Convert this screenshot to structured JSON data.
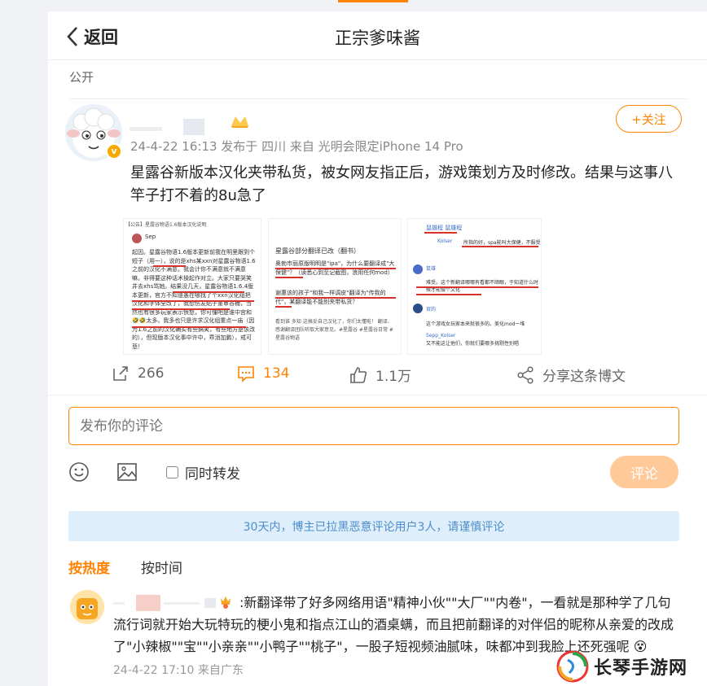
{
  "header": {
    "back_label": "返回",
    "title": "正宗爹味酱"
  },
  "visibility": "公开",
  "post": {
    "meta": "24-4-22 16:13  发布于 四川  来自 光明会限定iPhone 14 Pro",
    "follow_label": "+关注",
    "text": "星露谷新版本汉化夹带私货，被女网友指正后，游戏策划方及时修改。结果与这事八竿子打不着的8u急了",
    "images": [
      {
        "title": "【公告】星露谷物语1.6版本汉化说明",
        "author": "Sep",
        "paragraph": "起因。星露谷物语1.6版本更新前我在明里跟到个短子（用一），说的是xhs某xxn对星露谷物语1.6之前的汉化不满意。我会计你不满意就不满意嘛。非得要这种话术操起作对立。大家只要哭笑井去xhs骂她。结果没几天，星露谷物语1.6.4版本更新，官方不知道愚在哪找了个xxn汉化组把汉化和字体全改了，我想伤友贴子重审谷桶，当然也有很多玩家表示愤怒，你可懂吧是谁中宫和🤣🤣太多。我多也只是许求汉化组重点一庙（因为1.6之前的汉化确实有些搞笑，有些地方是该改的），但现版本汉化事中许中，乖消加鹏），戒可悲！"
      },
      {
        "heading": "星露谷部分翻译已改（翻书）",
        "body1": "奥勃市丽原版明明是\"ipa\"，为什么要翻译成\"大保健\"？（读悉心到至记截图，浪用任何mod）",
        "body2": "谢惠该的孩子\"和我一样调皮\"翻译为\"传我的代\"，某翻译能不能别夹带私货？",
        "footer": "看到谁 多知 这搞妥自己汉化了，你们太懂啦！   翻译、感谢翻译团队听取大家意见。#星露谷 #星露谷日常 #星露谷物语"
      },
      {
        "top": "鼠雄程 鼠雄程",
        "c1_name": "Kolser",
        "c1_text": "所指的好，spa能叫大保健，不服受着",
        "c2_name": "鼠雄",
        "c2_text": "难受。这个新翻译哪哪有看都不顺眼，于知道什么时候才能做个文化",
        "c3_name": "官的",
        "c3_text": "这个游戏女玩家本来就很多的。美化mod一堆",
        "c4_name": "Sepp_Kolser",
        "c4_text": "又不能这让他们，你就们要哪多挑剔性别唱"
      }
    ]
  },
  "actions": {
    "repost_count": "266",
    "comment_count": "134",
    "like_count": "1.1万",
    "share_label": "分享这条博文"
  },
  "composer": {
    "placeholder": "发布你的评论",
    "repost_label": "同时转发",
    "submit_label": "评论"
  },
  "notice": "30天内，博主已拉黑恶意评论用户3人，请谨慎评论",
  "sort": {
    "hot": "按热度",
    "time": "按时间"
  },
  "comments": [
    {
      "text": ":新翻译带了好多网络用语\"精神小伙\"\"大厂\"\"内卷\"，一看就是那种学了几句流行词就开始大玩特玩的梗小鬼和指点江山的酒桌螨，而且把前翻译的对伴侣的昵称从亲爱的改成了\"小辣椒\"\"宝\"\"小亲亲\"\"小鸭子\"\"桃子\"，一股子短视频油腻味，味都冲到我脸上还死强呢",
      "meta": "24-4-22 17:10  来自广东"
    }
  ],
  "watermark": "长琴手游网",
  "colors": {
    "accent": "#ff8200",
    "notice_bg": "#dfeefb",
    "notice_text": "#4d8ecb",
    "submit_disabled": "#ffc999"
  }
}
